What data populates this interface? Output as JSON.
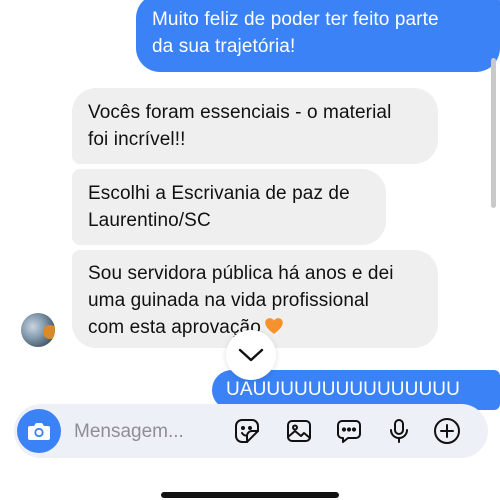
{
  "messages": [
    {
      "direction": "outgoing",
      "lines": [
        "Muito feliz de poder ter feito parte",
        "da sua trajetória!"
      ]
    },
    {
      "direction": "incoming",
      "lines": [
        "Vocês foram essenciais - o material",
        "foi incrível!!"
      ]
    },
    {
      "direction": "incoming",
      "lines": [
        "Escolhi a Escrivania de paz de",
        "Laurentino/SC"
      ]
    },
    {
      "direction": "incoming",
      "lines": [
        "Sou servidora pública há anos e dei",
        "uma guinada na vida profissional",
        "com esta aprovação"
      ],
      "emoji": "orange-heart-icon"
    },
    {
      "direction": "outgoing",
      "lines": [
        "UAUUUUUUUUUUUUUUU"
      ]
    }
  ],
  "composer": {
    "placeholder": "Mensagem..."
  },
  "colors": {
    "outgoing_bubble": "#3b82f6",
    "incoming_bubble": "#efefef",
    "heart": "#f5922e"
  }
}
